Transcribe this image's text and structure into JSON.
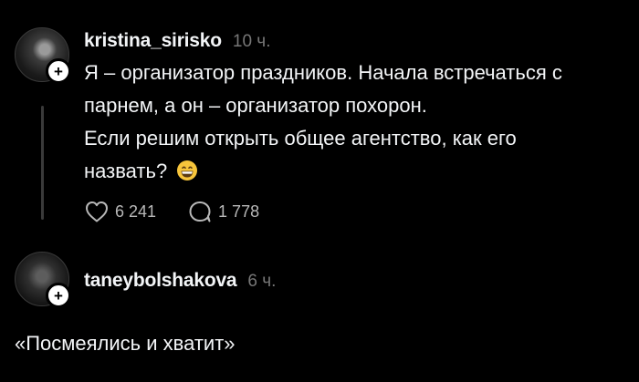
{
  "post": {
    "username": "kristina_sirisko",
    "time": "10 ч.",
    "lines": [
      "Я – организатор праздников. Начала встречаться с",
      "парнем, а он – организатор похорон.",
      "Если решим открыть общее агентство, как его",
      "назвать?"
    ],
    "emoji": "grinning-face",
    "likes": "6 241",
    "replies": "1 778"
  },
  "reply": {
    "username": "taneybolshakova",
    "time": "6 ч.",
    "text": "«Посмеялись и хватит»"
  },
  "icons": {
    "like": "heart-icon",
    "comment": "comment-bubble-icon",
    "follow": "plus-icon"
  }
}
